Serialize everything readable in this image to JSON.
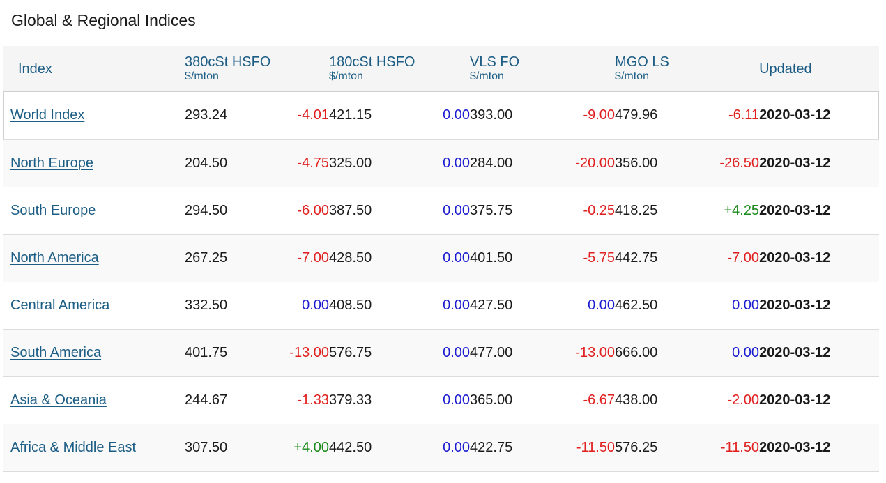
{
  "page_title": "Global & Regional Indices",
  "colors": {
    "header_text": "#1c5d85",
    "link": "#1c5d85",
    "negative": "#e0201f",
    "zero": "#1b1bd0",
    "positive": "#1b8a1b"
  },
  "headers": {
    "index": "Index",
    "hsfo380": {
      "label": "380cSt HSFO",
      "unit": "$/mton"
    },
    "hsfo180": {
      "label": "180cSt HSFO",
      "unit": "$/mton"
    },
    "vlsfo": {
      "label": "VLS FO",
      "unit": "$/mton"
    },
    "mgols": {
      "label": "MGO LS",
      "unit": "$/mton"
    },
    "updated": "Updated"
  },
  "rows": [
    {
      "name": "World Index",
      "hsfo380": "293.24",
      "hsfo380_chg": "-4.01",
      "hsfo180": "421.15",
      "hsfo180_chg": "0.00",
      "vlsfo": "393.00",
      "vlsfo_chg": "-9.00",
      "mgols": "479.96",
      "mgols_chg": "-6.11",
      "updated": "2020-03-12"
    },
    {
      "name": "North Europe",
      "hsfo380": "204.50",
      "hsfo380_chg": "-4.75",
      "hsfo180": "325.00",
      "hsfo180_chg": "0.00",
      "vlsfo": "284.00",
      "vlsfo_chg": "-20.00",
      "mgols": "356.00",
      "mgols_chg": "-26.50",
      "updated": "2020-03-12"
    },
    {
      "name": "South Europe",
      "hsfo380": "294.50",
      "hsfo380_chg": "-6.00",
      "hsfo180": "387.50",
      "hsfo180_chg": "0.00",
      "vlsfo": "375.75",
      "vlsfo_chg": "-0.25",
      "mgols": "418.25",
      "mgols_chg": "+4.25",
      "updated": "2020-03-12"
    },
    {
      "name": "North America",
      "hsfo380": "267.25",
      "hsfo380_chg": "-7.00",
      "hsfo180": "428.50",
      "hsfo180_chg": "0.00",
      "vlsfo": "401.50",
      "vlsfo_chg": "-5.75",
      "mgols": "442.75",
      "mgols_chg": "-7.00",
      "updated": "2020-03-12"
    },
    {
      "name": "Central America",
      "hsfo380": "332.50",
      "hsfo380_chg": "0.00",
      "hsfo180": "408.50",
      "hsfo180_chg": "0.00",
      "vlsfo": "427.50",
      "vlsfo_chg": "0.00",
      "mgols": "462.50",
      "mgols_chg": "0.00",
      "updated": "2020-03-12"
    },
    {
      "name": "South America",
      "hsfo380": "401.75",
      "hsfo380_chg": "-13.00",
      "hsfo180": "576.75",
      "hsfo180_chg": "0.00",
      "vlsfo": "477.00",
      "vlsfo_chg": "-13.00",
      "mgols": "666.00",
      "mgols_chg": "0.00",
      "updated": "2020-03-12"
    },
    {
      "name": "Asia & Oceania",
      "hsfo380": "244.67",
      "hsfo380_chg": "-1.33",
      "hsfo180": "379.33",
      "hsfo180_chg": "0.00",
      "vlsfo": "365.00",
      "vlsfo_chg": "-6.67",
      "mgols": "438.00",
      "mgols_chg": "-2.00",
      "updated": "2020-03-12"
    },
    {
      "name": "Africa & Middle East",
      "hsfo380": "307.50",
      "hsfo380_chg": "+4.00",
      "hsfo180": "442.50",
      "hsfo180_chg": "0.00",
      "vlsfo": "422.75",
      "vlsfo_chg": "-11.50",
      "mgols": "576.25",
      "mgols_chg": "-11.50",
      "updated": "2020-03-12"
    }
  ]
}
